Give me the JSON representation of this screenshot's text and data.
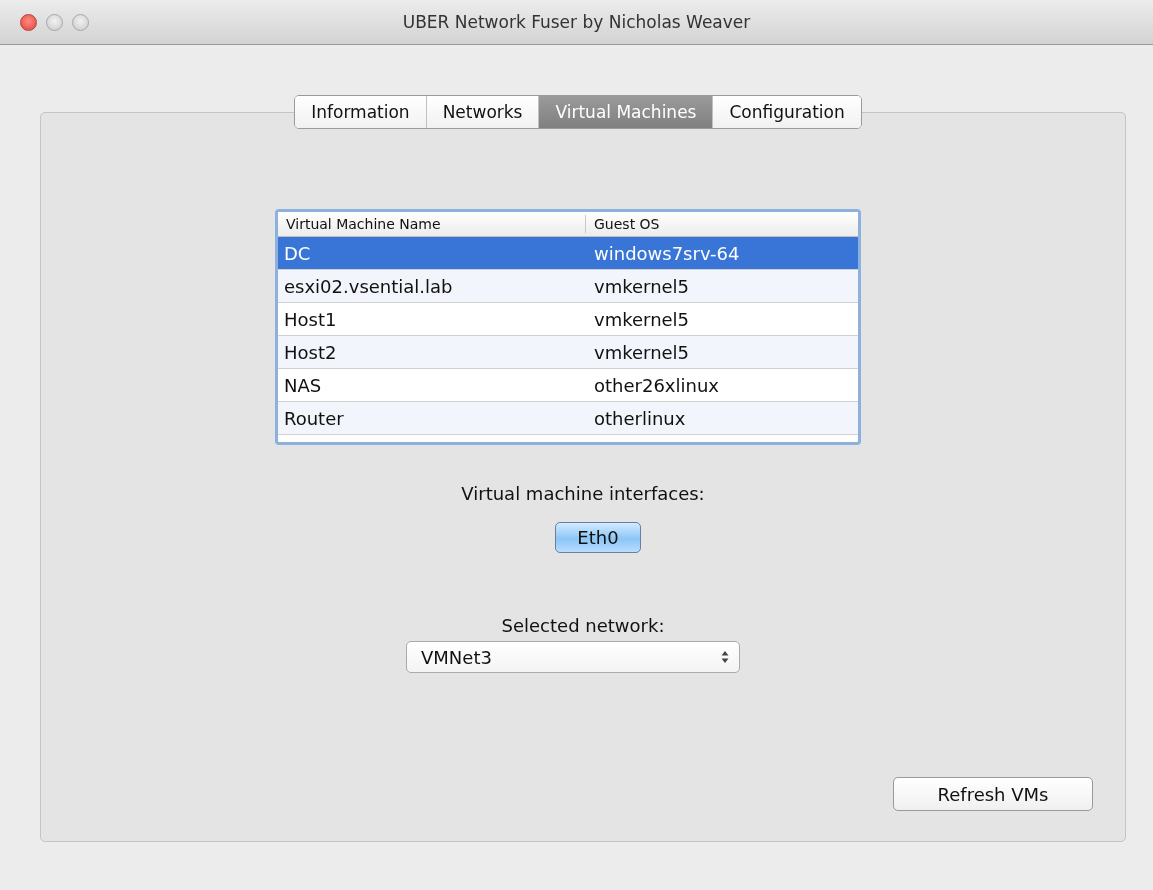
{
  "window": {
    "title": "UBER Network Fuser by Nicholas Weaver"
  },
  "tabs": [
    {
      "label": "Information",
      "selected": false
    },
    {
      "label": "Networks",
      "selected": false
    },
    {
      "label": "Virtual Machines",
      "selected": true
    },
    {
      "label": "Configuration",
      "selected": false
    }
  ],
  "table": {
    "columns": [
      "Virtual Machine Name",
      "Guest OS"
    ],
    "rows": [
      {
        "cells": [
          "DC",
          "windows7srv-64"
        ],
        "selected": true
      },
      {
        "cells": [
          "esxi02.vsential.lab",
          "vmkernel5"
        ],
        "selected": false
      },
      {
        "cells": [
          "Host1",
          "vmkernel5"
        ],
        "selected": false
      },
      {
        "cells": [
          "Host2",
          "vmkernel5"
        ],
        "selected": false
      },
      {
        "cells": [
          "NAS",
          "other26xlinux"
        ],
        "selected": false
      },
      {
        "cells": [
          "Router",
          "otherlinux"
        ],
        "selected": false
      }
    ]
  },
  "interfaces": {
    "label": "Virtual machine interfaces:",
    "buttons": [
      {
        "label": "Eth0",
        "selected": true
      }
    ]
  },
  "network": {
    "label": "Selected network:",
    "value": "VMNet3"
  },
  "refresh_button": "Refresh VMs"
}
